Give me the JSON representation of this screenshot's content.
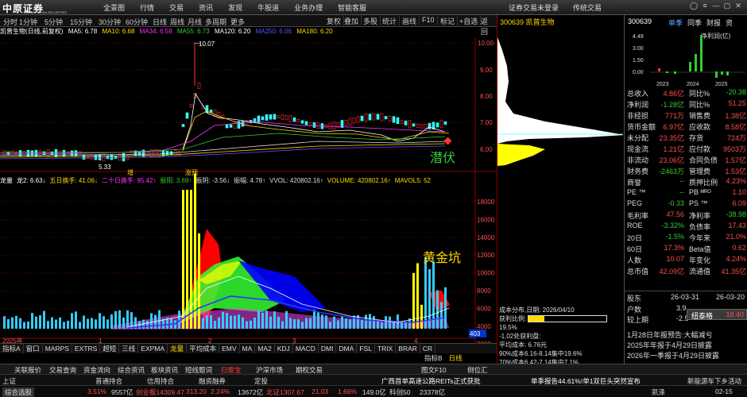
{
  "app": {
    "logo_text": "中原证券",
    "logo_en": "CENTRAL CHINA SECURITIES"
  },
  "topmenu": [
    "全景图",
    "行情",
    "交易",
    "资讯",
    "发现",
    "牛股道",
    "业务办理",
    "智能客服"
  ],
  "topright": [
    "证券交易未登录",
    "传统交易"
  ],
  "periods": [
    "分时",
    "1分钟",
    "5分钟",
    "15分钟",
    "30分钟",
    "60分钟",
    "日线",
    "周线",
    "月线",
    "多周期",
    "更多"
  ],
  "active_period": "日线",
  "tools": [
    "复权",
    "叠加",
    "多股",
    "统计",
    "画线",
    "F10",
    "标记",
    "+自选",
    "返回"
  ],
  "ma": {
    "title": "凯普生物(日线,前复权)",
    "ma5": "MA5: 6.78",
    "ma10": "MA10: 6.68",
    "ma34": "MA34: 6.59",
    "ma55": "MA55: 6.73",
    "ma120": "MA120: 6.20",
    "ma250": "MA250: 6.06",
    "ma180": "MA180: 6.20"
  },
  "chart_upper": {
    "high_label": "10.07",
    "low_label": "5.33",
    "price_ticks": [
      "10.00",
      "9.00",
      "8.00",
      "7.00",
      "6.00"
    ],
    "signal": "潜伏",
    "markers": [
      "增",
      "涨预"
    ]
  },
  "ind_line": "龙量 龙2: 6.63↓ 五日换手: 41.06↓ 二十日换手: 95.42↑ 振阳: 3.69↑ 振阴: -3.56↓ 振幅: 4.78↑ VVOL: 420802.16↑ VOLUME: 420802.16↑ MAVOL5: 52",
  "ind_parts": [
    {
      "t": "龙量",
      "c": "#fff"
    },
    {
      "t": "龙2: 6.63↓",
      "c": "#fff"
    },
    {
      "t": "五日换手: 41.06↓",
      "c": "#ffd900"
    },
    {
      "t": "二十日换手: 95.42↑",
      "c": "#f3f"
    },
    {
      "t": "振阳: 3.69↑",
      "c": "#3c3"
    },
    {
      "t": "振阴: -3.56↓",
      "c": "#ddd"
    },
    {
      "t": "振幅: 4.78↑",
      "c": "#ddd"
    },
    {
      "t": "VVOL: 420802.16↑",
      "c": "#ddd"
    },
    {
      "t": "VOLUME: 420802.16↑",
      "c": "#ffd900"
    },
    {
      "t": "MAVOL5: 52",
      "c": "#ffd900"
    }
  ],
  "chart_lower": {
    "vol_ticks": [
      "18000",
      "16000",
      "14000",
      "12000",
      "10000",
      "8000",
      "6000",
      "4000",
      "2000"
    ],
    "signal": "黄金坑",
    "last_label": "403"
  },
  "time_axis": [
    "2025年",
    "1",
    "2",
    "3",
    "4"
  ],
  "chart_data": {
    "type": "candlestick",
    "dates": [],
    "ohlc": [],
    "note_high": 10.07,
    "note_low": 5.33
  },
  "right_header": {
    "code": "300639",
    "name": "凯普生物"
  },
  "cost": {
    "date": "成本分布,日期: 2026/04/10",
    "ratio_label": "获利比例:",
    "ratio_value": "19.5%",
    "ratio": 0.195,
    "zero_line": "-1.02处获利盘:",
    "avg": "平均成本: 6.76元",
    "c90": "90%成本6.16-8.14集中19.6%",
    "c70": "70%成本6.42-7.14集中7.1%"
  },
  "rpanel": {
    "code": "300639",
    "tabs": [
      "单季",
      "同季",
      "财报",
      "资"
    ],
    "mini_title": "净利润(亿)",
    "mini_ticks": [
      "4.49",
      "3.00",
      "1.50",
      "0.00"
    ],
    "mini_years": [
      "2023",
      "2024",
      "2025"
    ],
    "rows": [
      [
        "总收入",
        "4.86亿",
        "同比%",
        "-20.38"
      ],
      [
        "净利润",
        "-1.28亿",
        "同比%",
        "51.25"
      ],
      [
        "非经损",
        "771万",
        "销售费",
        "1.38亿"
      ],
      [
        "货币金额",
        "6.97亿",
        "应收款",
        "8.58亿"
      ],
      [
        "未分配",
        "23.35亿",
        "存货",
        "724万"
      ],
      [
        "现金流",
        "1.21亿",
        "应付款",
        "9503万"
      ],
      [
        "非流动",
        "23.06亿",
        "合同负债",
        "1.57亿"
      ],
      [
        "财务费",
        "-2463万",
        "管理费",
        "1.53亿"
      ],
      [
        "商誉",
        "--",
        "质押比例",
        "4.23%"
      ],
      [
        "PE ™",
        "--",
        "PB ᴹᴿᴼ",
        "1.10"
      ],
      [
        "PEG",
        "-0.33",
        "PS ™",
        "6.09"
      ],
      [
        "毛利率",
        "47.56",
        "净利率",
        "-38.98"
      ],
      [
        "ROE",
        "-3.32%",
        "负债率",
        "17.43"
      ],
      [
        "20日",
        "-1.5%",
        "今年来",
        "21.0%"
      ],
      [
        "60日",
        "17.3%",
        "Beta值",
        "0.62"
      ],
      [
        "人数",
        "10.07",
        "年变化",
        "4.24%"
      ],
      [
        "总市值",
        "42.09亿",
        "流通值",
        "41.35亿"
      ]
    ],
    "shareholder": {
      "label": "股东",
      "d1": "26-03-31",
      "d2": "26-03-20",
      "r1": "户数",
      "r1v": "3.9",
      "r2": "较上期",
      "r2v": "-2.5"
    },
    "tooltip": {
      "name": "纽泰格",
      "value": "18.40"
    },
    "news": [
      "1月28日年报预告:大幅减亏",
      "2025年年报于4月29日披露",
      "2026年一季报于4月29日披露"
    ]
  },
  "tabs": [
    "指标A",
    "窗口",
    "MARPS",
    "EXTRS",
    "超短",
    "三线",
    "EXPMA",
    "龙量",
    "平均成本",
    "EMV",
    "MA",
    "MA2",
    "KDJ",
    "MACD",
    "DMI",
    "DMA",
    "FSL",
    "TRIX",
    "BRAR",
    "CR"
  ],
  "tabs_right": [
    "指标B",
    "日线"
  ],
  "bbar": [
    "关联报价",
    "交易查询",
    "资金流向",
    "综合资讯",
    "板块资讯",
    "短线题词",
    "扫雷宝",
    "沪深市场",
    "期权交易",
    "图文F10",
    "倒位汇"
  ],
  "sbar": {
    "items": [
      "上证",
      "普通持合",
      "信用持合",
      "融资融券",
      "定投",
      "广西首单高速公路REITs正式获批",
      "单季报告已上岗提交"
    ],
    "fav": "单季报告44.61%!单1双巨头突然宣布",
    "r": "新能源车下乡活动"
  },
  "tbar": {
    "label": "综合选股",
    "vals": [
      "3.51%",
      "9557亿",
      "创业板14309.47",
      "313.20",
      "2.24%",
      "13672亿",
      "北证1307.67",
      "21.03",
      "1.66%",
      "149.0亿",
      "科创50",
      "23378亿",
      "凯泽",
      "02-15"
    ]
  }
}
